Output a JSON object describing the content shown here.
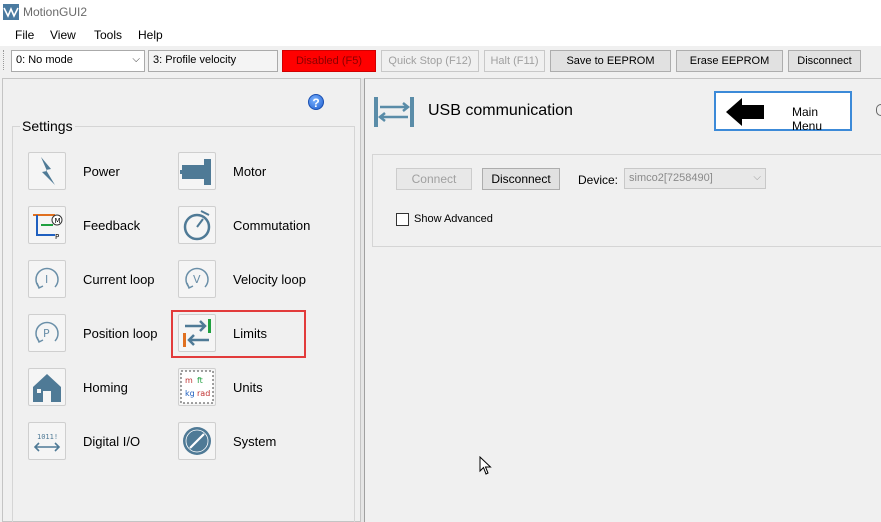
{
  "window": {
    "title": "MotionGUI2"
  },
  "menu": {
    "items": [
      "File",
      "View",
      "Tools",
      "Help"
    ]
  },
  "toolbar": {
    "mode_select": "0: No mode",
    "operation_mode": "3: Profile velocity",
    "buttons": {
      "disabled": "Disabled (F5)",
      "quick_stop": "Quick Stop (F12)",
      "halt": "Halt (F11)",
      "save_eeprom": "Save to EEPROM",
      "erase_eeprom": "Erase EEPROM",
      "disconnect": "Disconnect"
    },
    "colors": {
      "disabled_bg": "#ff0000"
    }
  },
  "settings": {
    "title": "Settings",
    "help_glyph": "?",
    "items": [
      {
        "label": "Power",
        "icon": "power-icon"
      },
      {
        "label": "Motor",
        "icon": "motor-icon"
      },
      {
        "label": "Feedback",
        "icon": "feedback-icon"
      },
      {
        "label": "Commutation",
        "icon": "commutation-icon"
      },
      {
        "label": "Current loop",
        "icon": "current-loop-icon"
      },
      {
        "label": "Velocity loop",
        "icon": "velocity-loop-icon"
      },
      {
        "label": "Position loop",
        "icon": "position-loop-icon"
      },
      {
        "label": "Limits",
        "icon": "limits-icon"
      },
      {
        "label": "Homing",
        "icon": "homing-icon"
      },
      {
        "label": "Units",
        "icon": "units-icon"
      },
      {
        "label": "Digital I/O",
        "icon": "digital-io-icon"
      },
      {
        "label": "System",
        "icon": "system-icon"
      }
    ],
    "highlighted": "Limits"
  },
  "usb": {
    "title": "USB communication",
    "main_menu": "Main Menu",
    "connect": "Connect",
    "disconnect": "Disconnect",
    "device_label": "Device:",
    "device_value": "simco2[7258490]",
    "show_advanced": "Show Advanced",
    "show_advanced_checked": false
  },
  "icon_glyphs": {
    "current": "I",
    "velocity": "V",
    "position": "P",
    "digital": "1011!",
    "feedback_motor": "M",
    "feedback_p": "P",
    "units": [
      "m",
      "ft",
      "kg",
      "rad"
    ]
  }
}
